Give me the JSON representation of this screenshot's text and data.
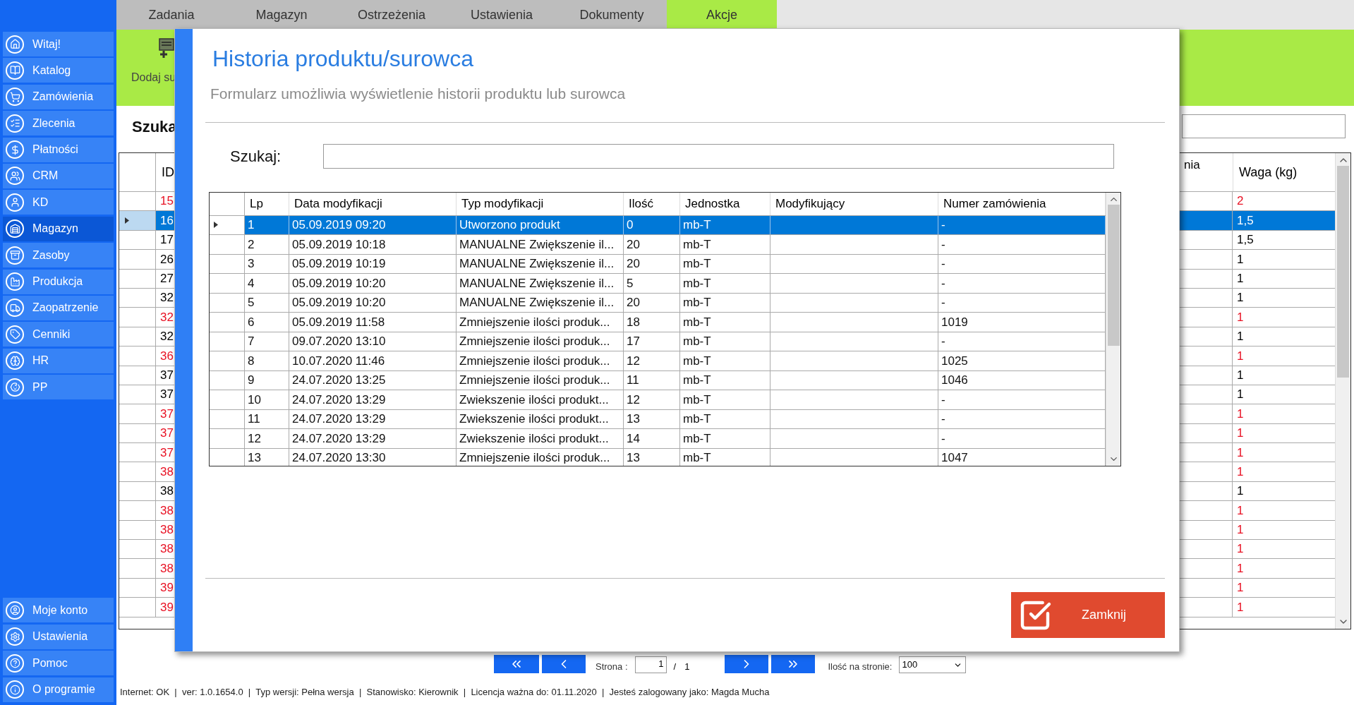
{
  "sidebar": {
    "items": [
      {
        "label": "Witaj!",
        "selected": false
      },
      {
        "label": "Katalog",
        "selected": false
      },
      {
        "label": "Zamówienia",
        "selected": false
      },
      {
        "label": "Zlecenia",
        "selected": false
      },
      {
        "label": "Płatności",
        "selected": false
      },
      {
        "label": "CRM",
        "selected": false
      },
      {
        "label": "KD",
        "selected": false
      },
      {
        "label": "Magazyn",
        "selected": true
      },
      {
        "label": "Zasoby",
        "selected": false
      },
      {
        "label": "Produkcja",
        "selected": false
      },
      {
        "label": "Zaopatrzenie",
        "selected": false
      },
      {
        "label": "Cenniki",
        "selected": false
      },
      {
        "label": "HR",
        "selected": false
      },
      {
        "label": "PP",
        "selected": false
      }
    ],
    "bottom_items": [
      {
        "label": "Moje konto",
        "selected": false
      },
      {
        "label": "Ustawienia",
        "selected": false
      },
      {
        "label": "Pomoc",
        "selected": false
      },
      {
        "label": "O programie",
        "selected": false
      }
    ]
  },
  "tabs": [
    {
      "label": "Zadania",
      "selected": false
    },
    {
      "label": "Magazyn",
      "selected": false
    },
    {
      "label": "Ostrzeżenia",
      "selected": false
    },
    {
      "label": "Ustawienia",
      "selected": false
    },
    {
      "label": "Dokumenty",
      "selected": false
    },
    {
      "label": "Akcje",
      "selected": true
    }
  ],
  "toolbar": {
    "button_label": "Dodaj su"
  },
  "search": {
    "label": "Szuka"
  },
  "grid": {
    "columns": [
      "ID",
      "nia",
      "Waga (kg)"
    ],
    "rows": [
      {
        "id": "15",
        "weight": "2",
        "alert": true,
        "selected": false
      },
      {
        "id": "16",
        "weight": "1,5",
        "alert": false,
        "selected": true
      },
      {
        "id": "17",
        "weight": "1,5",
        "alert": false,
        "selected": false
      },
      {
        "id": "26",
        "weight": "1",
        "alert": false,
        "selected": false
      },
      {
        "id": "27",
        "weight": "1",
        "alert": false,
        "selected": false
      },
      {
        "id": "32",
        "weight": "1",
        "alert": false,
        "selected": false
      },
      {
        "id": "32",
        "weight": "1",
        "alert": true,
        "selected": false
      },
      {
        "id": "32",
        "weight": "1",
        "alert": false,
        "selected": false
      },
      {
        "id": "36",
        "weight": "1",
        "alert": true,
        "selected": false
      },
      {
        "id": "37",
        "weight": "1",
        "alert": false,
        "selected": false
      },
      {
        "id": "37",
        "weight": "1",
        "alert": false,
        "selected": false
      },
      {
        "id": "37",
        "weight": "1",
        "alert": true,
        "selected": false
      },
      {
        "id": "37",
        "weight": "1",
        "alert": true,
        "selected": false
      },
      {
        "id": "37",
        "weight": "1",
        "alert": true,
        "selected": false
      },
      {
        "id": "38",
        "weight": "1",
        "alert": true,
        "selected": false
      },
      {
        "id": "38",
        "weight": "1",
        "alert": false,
        "selected": false
      },
      {
        "id": "38",
        "weight": "1",
        "alert": true,
        "selected": false
      },
      {
        "id": "38",
        "weight": "1",
        "alert": true,
        "selected": false
      },
      {
        "id": "38",
        "weight": "1",
        "alert": true,
        "selected": false
      },
      {
        "id": "38",
        "weight": "1",
        "alert": true,
        "selected": false
      },
      {
        "id": "39",
        "weight": "1",
        "alert": true,
        "selected": false
      },
      {
        "id": "39",
        "weight": "1",
        "alert": true,
        "selected": false
      }
    ]
  },
  "pager": {
    "page_label": "Strona :",
    "page": "1",
    "separator": "/",
    "total": "1",
    "per_page_label": "Ilość na stronie:",
    "per_page": "100"
  },
  "status_bar": "Internet: OK  |  ver: 1.0.1654.0  |  Typ wersji: Pełna wersja  |  Stanowisko: Kierownik  |  Licencja ważna do: 01.11.2020  |  Jesteś zalogowany jako: Magda Mucha",
  "dialog": {
    "title": "Historia produktu/surowca",
    "subtitle": "Formularz umożliwia wyświetlenie historii produktu lub surowca",
    "search_label": "Szukaj:",
    "table": {
      "columns": [
        "Lp",
        "Data modyfikacji",
        "Typ modyfikacji",
        "Ilość",
        "Jednostka",
        "Modyfikujący",
        "Numer zamówienia"
      ],
      "rows": [
        {
          "lp": "1",
          "date": "05.09.2019 09:20",
          "type": "Utworzono produkt",
          "qty": "0",
          "unit": "mb-T",
          "order": "-",
          "selected": true
        },
        {
          "lp": "2",
          "date": "05.09.2019 10:18",
          "type": "MANUALNE Zwiększenie il...",
          "qty": "20",
          "unit": "mb-T",
          "order": "-",
          "selected": false
        },
        {
          "lp": "3",
          "date": "05.09.2019 10:19",
          "type": "MANUALNE Zwiększenie il...",
          "qty": "20",
          "unit": "mb-T",
          "order": "-",
          "selected": false
        },
        {
          "lp": "4",
          "date": "05.09.2019 10:20",
          "type": "MANUALNE Zwiększenie il...",
          "qty": "5",
          "unit": "mb-T",
          "order": "-",
          "selected": false
        },
        {
          "lp": "5",
          "date": "05.09.2019 10:20",
          "type": "MANUALNE Zwiększenie il...",
          "qty": "20",
          "unit": "mb-T",
          "order": "-",
          "selected": false
        },
        {
          "lp": "6",
          "date": "05.09.2019 11:58",
          "type": "Zmniejszenie ilości produk...",
          "qty": "18",
          "unit": "mb-T",
          "order": "1019",
          "selected": false
        },
        {
          "lp": "7",
          "date": "09.07.2020 13:10",
          "type": "Zmniejszenie ilości produk...",
          "qty": "17",
          "unit": "mb-T",
          "order": "-",
          "selected": false
        },
        {
          "lp": "8",
          "date": "10.07.2020 11:46",
          "type": "Zmniejszenie ilości produk...",
          "qty": "12",
          "unit": "mb-T",
          "order": "1025",
          "selected": false
        },
        {
          "lp": "9",
          "date": "24.07.2020 13:25",
          "type": "Zmniejszenie ilości produk...",
          "qty": "11",
          "unit": "mb-T",
          "order": "1046",
          "selected": false
        },
        {
          "lp": "10",
          "date": "24.07.2020 13:29",
          "type": "Zwiekszenie ilości produkt...",
          "qty": "12",
          "unit": "mb-T",
          "order": "-",
          "selected": false
        },
        {
          "lp": "11",
          "date": "24.07.2020 13:29",
          "type": "Zwiekszenie ilości produkt...",
          "qty": "13",
          "unit": "mb-T",
          "order": "-",
          "selected": false
        },
        {
          "lp": "12",
          "date": "24.07.2020 13:29",
          "type": "Zwiekszenie ilości produkt...",
          "qty": "14",
          "unit": "mb-T",
          "order": "-",
          "selected": false
        },
        {
          "lp": "13",
          "date": "24.07.2020 13:30",
          "type": "Zmniejszenie ilości produk...",
          "qty": "13",
          "unit": "mb-T",
          "order": "1047",
          "selected": false
        }
      ]
    },
    "close_button": "Zamknij"
  }
}
